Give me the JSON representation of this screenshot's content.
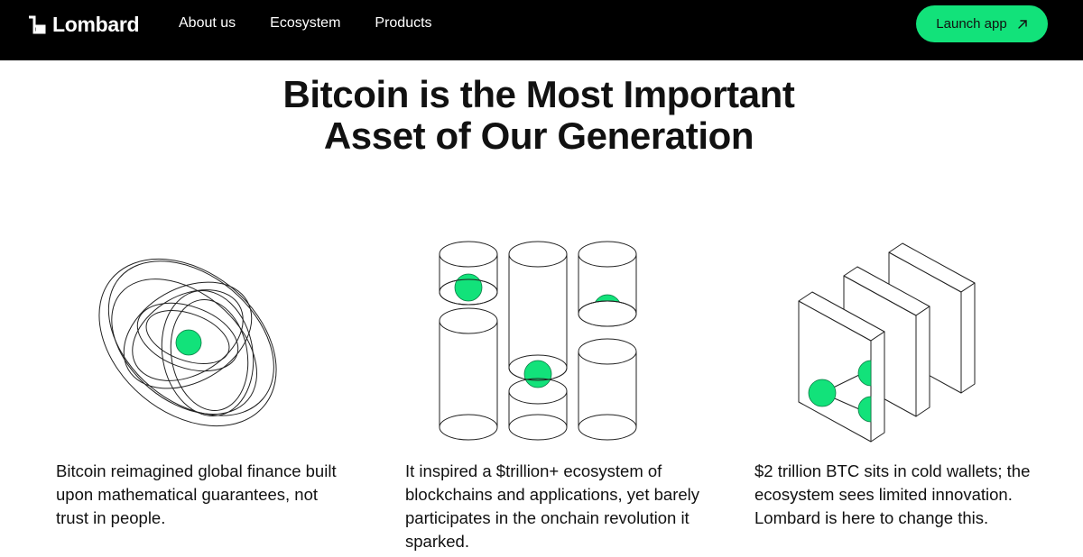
{
  "brand": {
    "name": "Lombard",
    "logo_icon": "lombard-logo-mark-icon"
  },
  "nav": {
    "items": [
      {
        "label": "About us"
      },
      {
        "label": "Ecosystem"
      },
      {
        "label": "Products"
      }
    ],
    "cta": {
      "label": "Launch app",
      "icon": "arrow-up-right-icon"
    }
  },
  "hero": {
    "title": "Bitcoin is the Most Important Asset of Our Generation"
  },
  "features": [
    {
      "illustration": "interlocking-rings-illustration",
      "text": "Bitcoin reimagined global finance built upon mathematical guarantees, not trust in people."
    },
    {
      "illustration": "cylinder-columns-illustration",
      "text": "It inspired a $trillion+ ecosystem of blockchains and applications, yet barely participates in the onchain revolution it sparked."
    },
    {
      "illustration": "cold-wallet-slabs-illustration",
      "text": "$2 trillion BTC sits in cold wallets; the ecosystem sees limited innovation. Lombard is here to change this."
    }
  ],
  "colors": {
    "nav_background": "#000000",
    "accent_green": "#12e27a",
    "page_background": "#ffffff",
    "text": "#111111",
    "line_art": "#222222"
  }
}
